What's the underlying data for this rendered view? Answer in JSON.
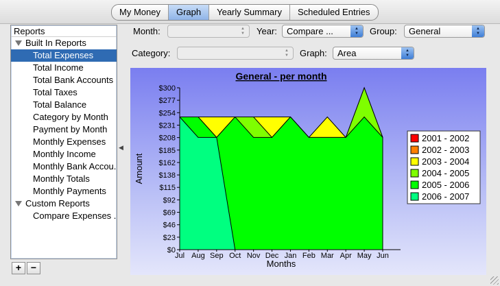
{
  "tabs": [
    {
      "label": "My Money",
      "selected": false
    },
    {
      "label": "Graph",
      "selected": true
    },
    {
      "label": "Yearly Summary",
      "selected": false
    },
    {
      "label": "Scheduled Entries",
      "selected": false
    }
  ],
  "sidebar": {
    "header": "Reports",
    "built_in_label": "Built In Reports",
    "built_in_items": [
      "Total Expenses",
      "Total Income",
      "Total Bank Accounts",
      "Total Taxes",
      "Total Balance",
      "Category by Month",
      "Payment by Month",
      "Monthly Expenses",
      "Monthly Income",
      "Monthly Bank Accou...",
      "Monthly Totals",
      "Monthly Payments"
    ],
    "selected_index": 0,
    "custom_label": "Custom Reports",
    "custom_items": [
      "Compare Expenses ..."
    ],
    "add_label": "+",
    "remove_label": "−"
  },
  "controls": {
    "month_label": "Month:",
    "month_value": "",
    "year_label": "Year:",
    "year_value": "Compare ...",
    "group_label": "Group:",
    "group_value": "General",
    "category_label": "Category:",
    "category_value": "",
    "graph_label": "Graph:",
    "graph_value": "Area"
  },
  "colors": {
    "2001 - 2002": "#ff0000",
    "2002 - 2003": "#ff7f00",
    "2003 - 2004": "#ffff00",
    "2004 - 2005": "#7fff00",
    "2005 - 2006": "#00ff00",
    "2006 - 2007": "#00ff80"
  },
  "chart_data": {
    "type": "area",
    "title": "General -  per month",
    "xlabel": "Months",
    "ylabel": "Amount",
    "categories": [
      "Jul",
      "Aug",
      "Sep",
      "Oct",
      "Nov",
      "Dec",
      "Jan",
      "Feb",
      "Mar",
      "Apr",
      "May",
      "Jun"
    ],
    "yticks": [
      "$0",
      "$23",
      "$46",
      "$69",
      "$92",
      "$115",
      "$138",
      "$162",
      "$185",
      "$208",
      "$231",
      "$254",
      "$277",
      "$300"
    ],
    "ylim": [
      0,
      300
    ],
    "legend_position": "right",
    "series": [
      {
        "name": "2001 - 2002",
        "values": [
          0,
          0,
          0,
          0,
          0,
          0,
          0,
          0,
          0,
          0,
          0,
          0
        ]
      },
      {
        "name": "2002 - 2003",
        "values": [
          0,
          0,
          0,
          0,
          0,
          0,
          0,
          0,
          0,
          0,
          0,
          0
        ]
      },
      {
        "name": "2003 - 2004",
        "values": [
          0,
          0,
          0,
          0,
          0,
          0,
          0,
          0,
          0,
          0,
          0,
          0
        ]
      },
      {
        "name": "2004 - 2005",
        "values": [
          0,
          0,
          0,
          0,
          0,
          0,
          0,
          0,
          0,
          0,
          0,
          0
        ]
      },
      {
        "name": "2005 - 2006",
        "values": [
          0,
          0,
          0,
          0,
          0,
          0,
          0,
          0,
          0,
          0,
          0,
          0
        ]
      },
      {
        "name": "2006 - 2007",
        "values": [
          246,
          208,
          208,
          0,
          0,
          0,
          0,
          0,
          0,
          0,
          0,
          0
        ]
      }
    ],
    "envelope": [
      {
        "series": "2005 - 2006",
        "values": [
          246,
          246,
          208,
          246,
          208,
          208,
          246,
          208,
          208,
          208,
          246,
          208
        ]
      },
      {
        "series": "2004 - 2005",
        "values": [
          246,
          246,
          208,
          246,
          246,
          208,
          246,
          208,
          208,
          208,
          300,
          208
        ]
      },
      {
        "series": "2003 - 2004",
        "values": [
          246,
          246,
          246,
          246,
          246,
          246,
          246,
          208,
          246,
          208,
          300,
          208
        ]
      }
    ]
  }
}
